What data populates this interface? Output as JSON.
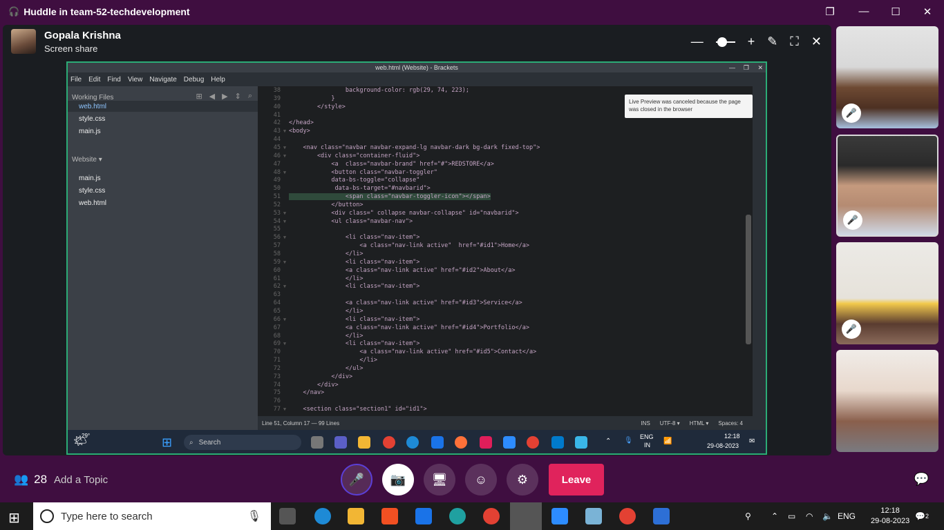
{
  "window": {
    "title": "Huddle in team-52-techdevelopment"
  },
  "presenter": {
    "name": "Gopala Krishna",
    "status": "Screen share"
  },
  "brackets": {
    "title": "web.html (Website) - Brackets",
    "menu": [
      "File",
      "Edit",
      "Find",
      "View",
      "Navigate",
      "Debug",
      "Help"
    ],
    "working_files_label": "Working Files",
    "working_files": [
      "web.html",
      "style.css",
      "main.js"
    ],
    "project_label": "Website ▾",
    "project_files": [
      "main.js",
      "style.css",
      "web.html"
    ],
    "tooltip": "Live Preview was canceled because the page was closed in the browser",
    "status_left": "Line 51, Column 17 — 99 Lines",
    "status_ins": "INS",
    "status_enc": "UTF-8 ▾",
    "status_lang": "HTML ▾",
    "status_spaces": "Spaces: 4",
    "code_lines": [
      {
        "n": "38",
        "fold": "",
        "text": "                background-color: rgb(29, 74, 223);"
      },
      {
        "n": "39",
        "fold": "",
        "text": "            }"
      },
      {
        "n": "40",
        "fold": "",
        "text": "        </style>"
      },
      {
        "n": "41",
        "fold": "",
        "text": ""
      },
      {
        "n": "42",
        "fold": "",
        "text": "</head>"
      },
      {
        "n": "43",
        "fold": "▼",
        "text": "<body>"
      },
      {
        "n": "44",
        "fold": "",
        "text": ""
      },
      {
        "n": "45",
        "fold": "▼",
        "text": "    <nav class=\"navbar navbar-expand-lg navbar-dark bg-dark fixed-top\">"
      },
      {
        "n": "46",
        "fold": "▼",
        "text": "        <div class=\"container-fluid\">"
      },
      {
        "n": "47",
        "fold": "",
        "text": "            <a  class=\"navbar-brand\" href=\"#\">REDSTORE</a>"
      },
      {
        "n": "48",
        "fold": "▼",
        "text": "            <button class=\"navbar-toggler\""
      },
      {
        "n": "49",
        "fold": "",
        "text": "            data-bs-toggle=\"collapse\""
      },
      {
        "n": "50",
        "fold": "",
        "text": "             data-bs-target=\"#navbarid\">"
      },
      {
        "n": "51",
        "fold": "",
        "text": "                <span class=\"navbar-toggler-icon\"></span>"
      },
      {
        "n": "52",
        "fold": "",
        "text": "            </button>"
      },
      {
        "n": "53",
        "fold": "▼",
        "text": "            <div class=\" collapse navbar-collapse\" id=\"navbarid\">"
      },
      {
        "n": "54",
        "fold": "▼",
        "text": "            <ul class=\"navbar-nav\">"
      },
      {
        "n": "55",
        "fold": "",
        "text": ""
      },
      {
        "n": "56",
        "fold": "▼",
        "text": "                <li class=\"nav-item\">"
      },
      {
        "n": "57",
        "fold": "",
        "text": "                    <a class=\"nav-link active\"  href=\"#id1\">Home</a>"
      },
      {
        "n": "58",
        "fold": "",
        "text": "                </li>"
      },
      {
        "n": "59",
        "fold": "▼",
        "text": "                <li class=\"nav-item\">"
      },
      {
        "n": "60",
        "fold": "",
        "text": "                <a class=\"nav-link active\" href=\"#id2\">About</a>"
      },
      {
        "n": "61",
        "fold": "",
        "text": "                </li>"
      },
      {
        "n": "62",
        "fold": "▼",
        "text": "                <li class=\"nav-item\">"
      },
      {
        "n": "63",
        "fold": "",
        "text": ""
      },
      {
        "n": "64",
        "fold": "",
        "text": "                <a class=\"nav-link active\" href=\"#id3\">Service</a>"
      },
      {
        "n": "65",
        "fold": "",
        "text": "                </li>"
      },
      {
        "n": "66",
        "fold": "▼",
        "text": "                <li class=\"nav-item\">"
      },
      {
        "n": "67",
        "fold": "",
        "text": "                <a class=\"nav-link active\" href=\"#id4\">Portfolio</a>"
      },
      {
        "n": "68",
        "fold": "",
        "text": "                </li>"
      },
      {
        "n": "69",
        "fold": "▼",
        "text": "                <li class=\"nav-item\">"
      },
      {
        "n": "70",
        "fold": "",
        "text": "                    <a class=\"nav-link active\" href=\"#id5\">Contact</a>"
      },
      {
        "n": "71",
        "fold": "",
        "text": "                    </li>"
      },
      {
        "n": "72",
        "fold": "",
        "text": "                </ul>"
      },
      {
        "n": "73",
        "fold": "",
        "text": "            </div>"
      },
      {
        "n": "74",
        "fold": "",
        "text": "        </div>"
      },
      {
        "n": "75",
        "fold": "",
        "text": "    </nav>"
      },
      {
        "n": "76",
        "fold": "",
        "text": ""
      },
      {
        "n": "77",
        "fold": "▼",
        "text": "    <section class=\"section1\" id=\"id1\">"
      }
    ]
  },
  "shared_taskbar": {
    "temp": "29°",
    "search": "Search",
    "lang": "ENG",
    "region": "IN",
    "time": "12:18",
    "date": "29-08-2023"
  },
  "huddle": {
    "people_count": "28",
    "add_topic": "Add a Topic",
    "leave": "Leave"
  },
  "taskbar": {
    "search_placeholder": "Type here to search",
    "lang": "ENG",
    "time": "12:18",
    "date": "29-08-2023",
    "notifications": "2"
  },
  "colors": {
    "leave": "#e0235c",
    "share_border": "#2bac76",
    "background": "#3f0e40"
  }
}
